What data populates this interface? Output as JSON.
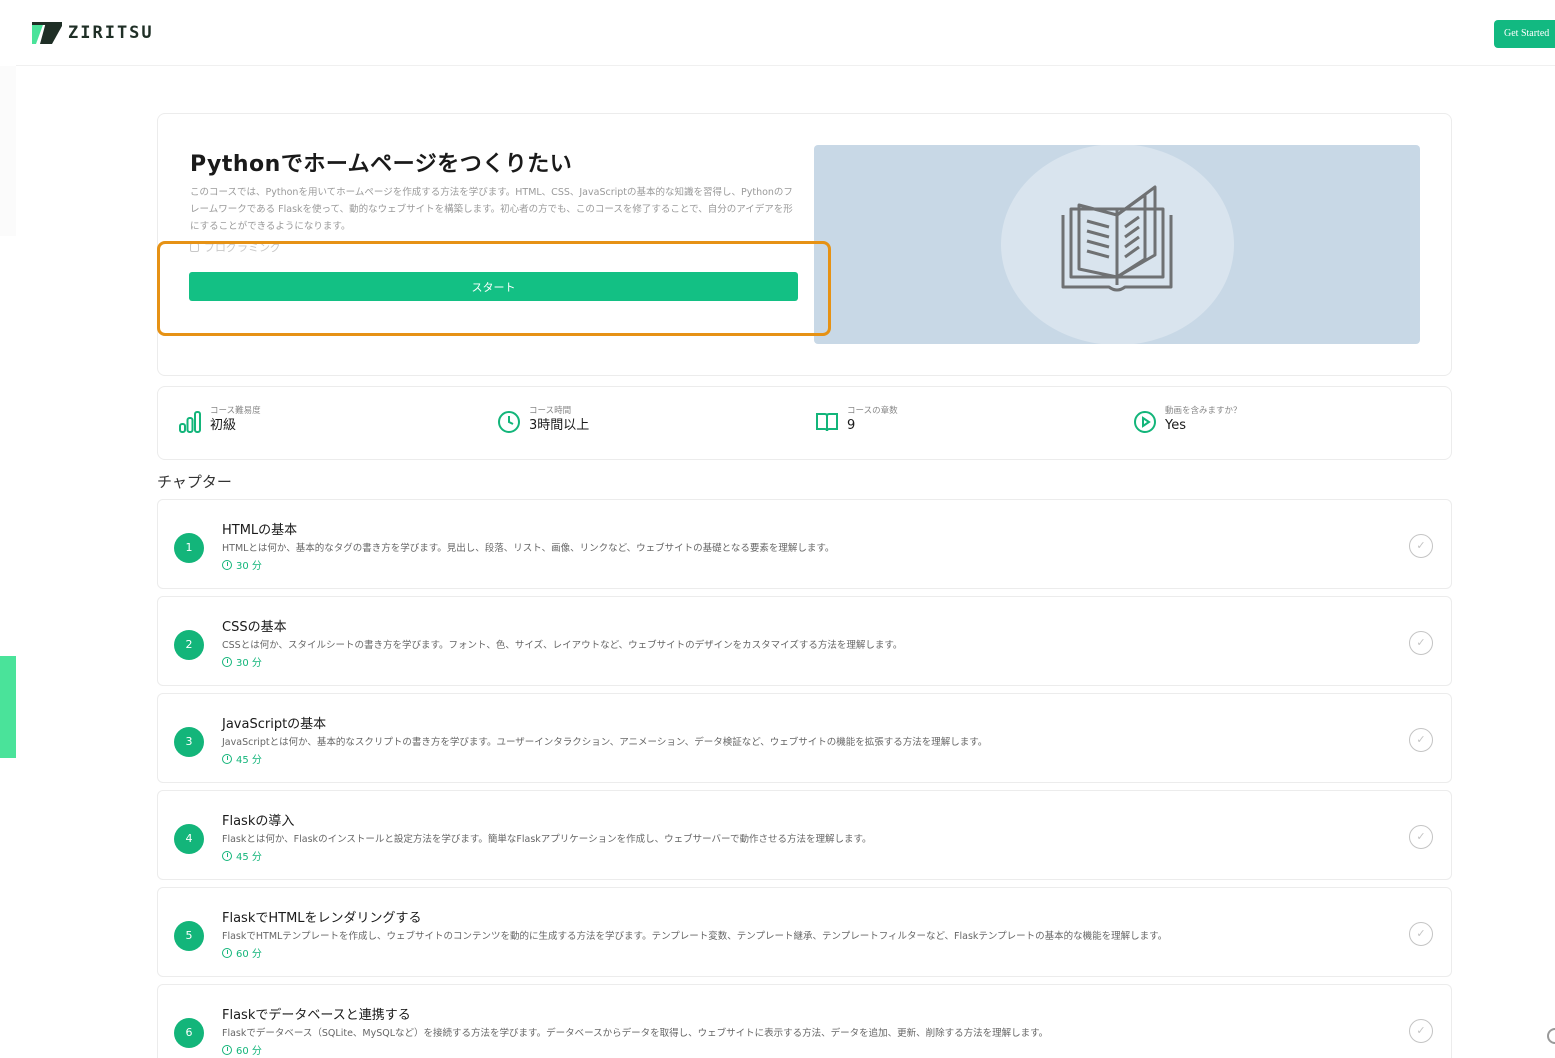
{
  "header": {
    "brand": "ZIRITSU",
    "cta_label": "Get Started"
  },
  "hero": {
    "title": "Pythonでホームページをつくりたい",
    "description": "このコースでは、Pythonを用いてホームページを作成する方法を学びます。HTML、CSS、JavaScriptの基本的な知識を習得し、Pythonのフレームワークである Flaskを使って、動的なウェブサイトを構築します。初心者の方でも、このコースを修了することで、自分のアイデアを形にすることができるようになります。",
    "tag": "プログラミング",
    "start_label": "スタート",
    "image_icon": "book-icon"
  },
  "stats": [
    {
      "label": "コース難易度",
      "value": "初級",
      "icon": "level-bars-icon"
    },
    {
      "label": "コース時間",
      "value": "3時間以上",
      "icon": "clock-icon"
    },
    {
      "label": "コースの章数",
      "value": "9",
      "icon": "open-book-icon"
    },
    {
      "label": "動画を含みますか？",
      "value": "Yes",
      "icon": "play-circle-icon"
    }
  ],
  "chapters_heading": "チャプター",
  "chapters": [
    {
      "number": "1",
      "title": "HTMLの基本",
      "description": "HTMLとは何か、基本的なタグの書き方を学びます。見出し、段落、リスト、画像、リンクなど、ウェブサイトの基礎となる要素を理解します。",
      "time": "30 分"
    },
    {
      "number": "2",
      "title": "CSSの基本",
      "description": "CSSとは何か、スタイルシートの書き方を学びます。フォント、色、サイズ、レイアウトなど、ウェブサイトのデザインをカスタマイズする方法を理解します。",
      "time": "30 分"
    },
    {
      "number": "3",
      "title": "JavaScriptの基本",
      "description": "JavaScriptとは何か、基本的なスクリプトの書き方を学びます。ユーザーインタラクション、アニメーション、データ検証など、ウェブサイトの機能を拡張する方法を理解します。",
      "time": "45 分"
    },
    {
      "number": "4",
      "title": "Flaskの導入",
      "description": "Flaskとは何か、Flaskのインストールと設定方法を学びます。簡単なFlaskアプリケーションを作成し、ウェブサーバーで動作させる方法を理解します。",
      "time": "45 分"
    },
    {
      "number": "5",
      "title": "FlaskでHTMLをレンダリングする",
      "description": "FlaskでHTMLテンプレートを作成し、ウェブサイトのコンテンツを動的に生成する方法を学びます。テンプレート変数、テンプレート継承、テンプレートフィルターなど、Flaskテンプレートの基本的な機能を理解します。",
      "time": "60 分"
    },
    {
      "number": "6",
      "title": "Flaskでデータベースと連携する",
      "description": "Flaskでデータベース（SQLite、MySQLなど）を接続する方法を学びます。データベースからデータを取得し、ウェブサイトに表示する方法、データを追加、更新、削除する方法を理解します。",
      "time": "60 分"
    }
  ],
  "colors": {
    "accent": "#13b57a",
    "highlight": "#e69215"
  }
}
